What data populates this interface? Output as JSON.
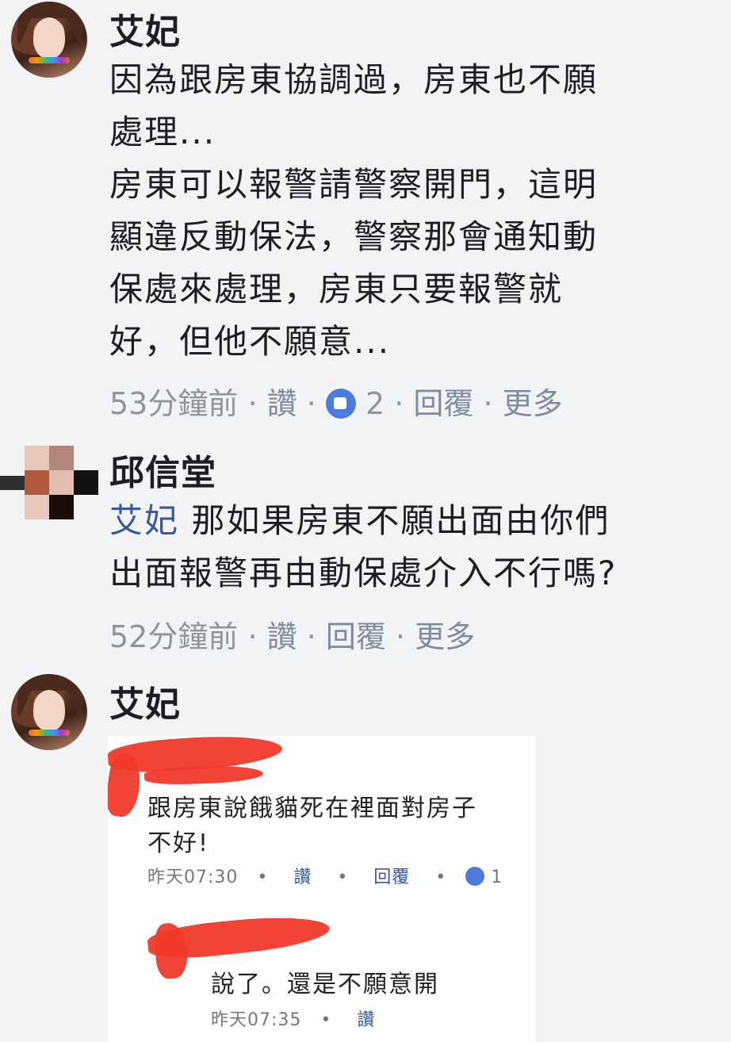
{
  "comments": [
    {
      "author": "艾妃",
      "lines": [
        "因為跟房東協調過，房東也不願",
        "處理...",
        "房東可以報警請警察開門，這明",
        "顯違反動保法，警察那會通知動",
        "保處來處理，房東只要報警就",
        "好，但他不願意..."
      ],
      "time": "53分鐘前",
      "like_label": "讚",
      "reaction_count": "2",
      "reply_label": "回覆",
      "more_label": "更多"
    },
    {
      "author": "邱信堂",
      "mention": "艾妃",
      "line1_rest": " 那如果房東不願出面由你們",
      "line2": "出面報警再由動保處介入不行嗎?",
      "time": "52分鐘前",
      "like_label": "讚",
      "reply_label": "回覆",
      "more_label": "更多"
    },
    {
      "author": "艾妃",
      "attachment": {
        "comment1_line1": "跟房東說餓貓死在裡面對房子",
        "comment1_line2": "不好!",
        "comment1_time": "昨天07:30",
        "comment1_like": "讚",
        "comment1_reply": "回覆",
        "comment1_count": "1",
        "comment2_text": "說了。還是不願意開",
        "comment2_time": "昨天07:35",
        "comment2_like": "讚"
      }
    }
  ],
  "colors": {
    "background": "#f2f3f5",
    "link": "#385898",
    "meta": "#90949c",
    "scribble": "#f13a2b"
  }
}
